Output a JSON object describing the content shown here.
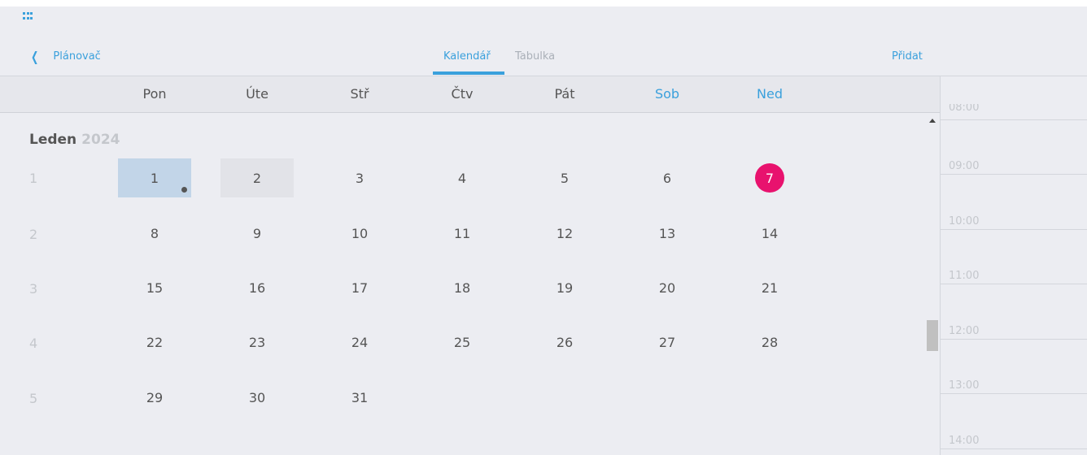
{
  "app_icon": "app-grid-icon",
  "nav": {
    "back_label": "Plánovač",
    "tabs": [
      {
        "label": "Kalendář",
        "active": true
      },
      {
        "label": "Tabulka",
        "active": false
      }
    ],
    "add_label": "Přidat"
  },
  "weekdays": [
    "Pon",
    "Úte",
    "Stř",
    "Čtv",
    "Pát",
    "Sob",
    "Ned"
  ],
  "month": {
    "name": "Leden",
    "year": "2024"
  },
  "weeks": [
    {
      "number": "1",
      "days": [
        "1",
        "2",
        "3",
        "4",
        "5",
        "6",
        "7"
      ]
    },
    {
      "number": "2",
      "days": [
        "8",
        "9",
        "10",
        "11",
        "12",
        "13",
        "14"
      ]
    },
    {
      "number": "3",
      "days": [
        "15",
        "16",
        "17",
        "18",
        "19",
        "20",
        "21"
      ]
    },
    {
      "number": "4",
      "days": [
        "22",
        "23",
        "24",
        "25",
        "26",
        "27",
        "28"
      ]
    },
    {
      "number": "5",
      "days": [
        "29",
        "30",
        "31"
      ]
    }
  ],
  "selected_day": "1",
  "hovered_day": "2",
  "today": "7",
  "event_dot_day": "1",
  "timeline": {
    "partial_label": "08:00",
    "hours": [
      "09:00",
      "10:00",
      "11:00",
      "12:00",
      "13:00",
      "14:00"
    ]
  },
  "colors": {
    "accent": "#3aa0dc",
    "today": "#e8126e",
    "selected": "#c2d5e8"
  }
}
